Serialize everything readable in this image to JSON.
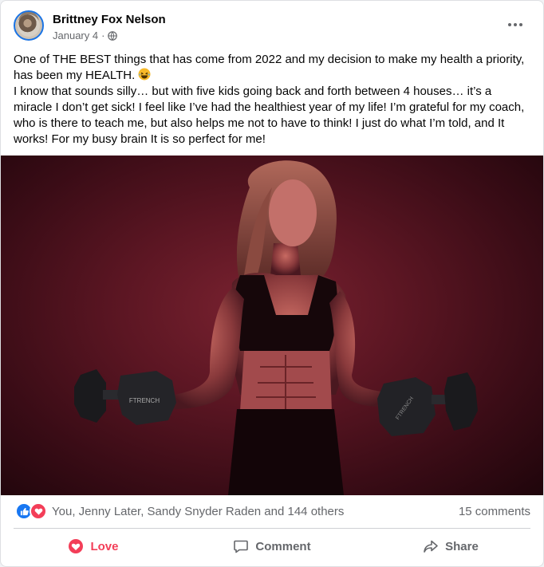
{
  "post": {
    "author": "Brittney Fox Nelson",
    "date": "January 4",
    "separator": "·",
    "privacy_icon": "globe-icon",
    "more_icon": "more-options-icon",
    "text_line1": "One of THE BEST things that has come from 2022 and my decision to make my health a priority, has been my HEALTH.",
    "text_line2": "I know that sounds silly… but with five kids going back and forth between 4 houses… it’s a miracle I don’t get sick! I feel like I’ve had the healthiest year of my life!      I’m grateful for my coach, who is there to teach me, but also helps me not to have to think! I just do what I’m told, and It works! For my busy brain It is so perfect for me!",
    "dumbbell_left_text": "FTRENCH",
    "dumbbell_right_text": "FTRENCH"
  },
  "stats": {
    "reactions_text": "You, Jenny Later, Sandy Snyder Raden and 144 others",
    "comments_text": "15 comments"
  },
  "actions": {
    "love_label": "Love",
    "comment_label": "Comment",
    "share_label": "Share"
  },
  "colors": {
    "brand_blue": "#1877f2",
    "love_red": "#f33e58",
    "secondary_text": "#65676b"
  }
}
